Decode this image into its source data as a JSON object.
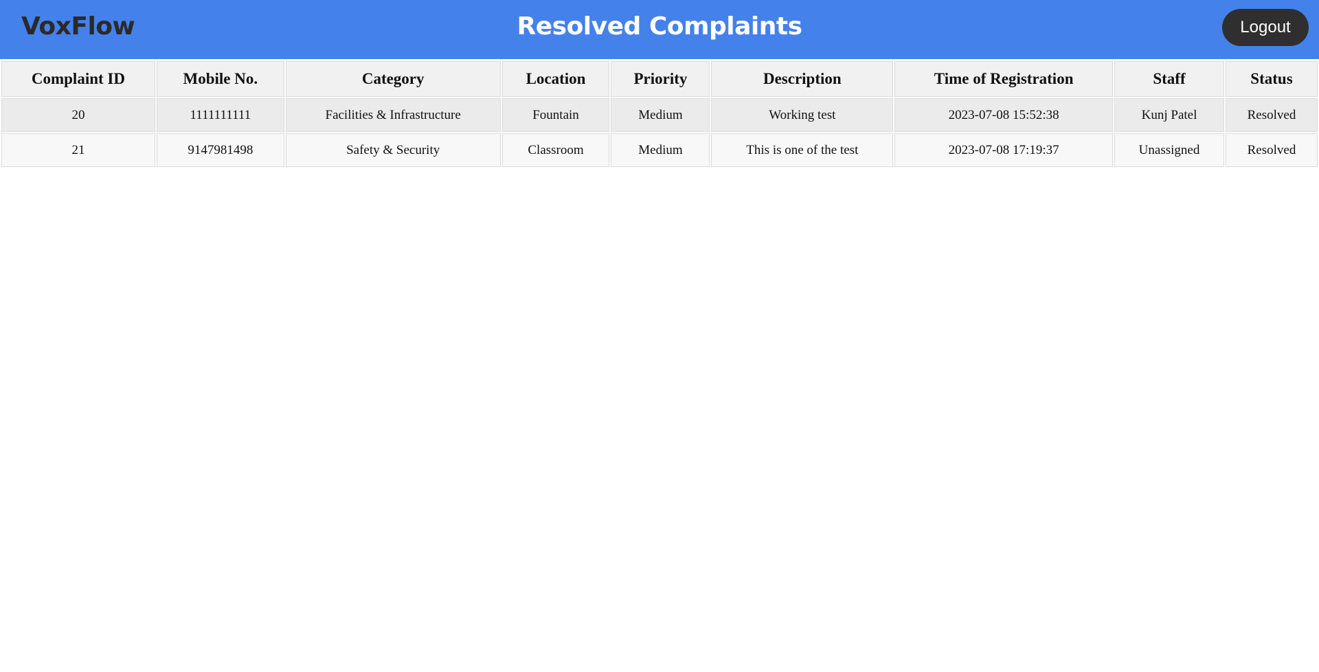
{
  "header": {
    "brand": "VoxFlow",
    "title": "Resolved Complaints",
    "logout_label": "Logout"
  },
  "colors": {
    "header_bg": "#4481ea",
    "logout_bg": "#2f2f2f"
  },
  "table": {
    "headers": [
      "Complaint ID",
      "Mobile No.",
      "Category",
      "Location",
      "Priority",
      "Description",
      "Time of Registration",
      "Staff",
      "Status"
    ],
    "rows": [
      [
        "20",
        "1111111111",
        "Facilities & Infrastructure",
        "Fountain",
        "Medium",
        "Working test",
        "2023-07-08 15:52:38",
        "Kunj Patel",
        "Resolved"
      ],
      [
        "21",
        "9147981498",
        "Safety & Security",
        "Classroom",
        "Medium",
        "This is one of the test",
        "2023-07-08 17:19:37",
        "Unassigned",
        "Resolved"
      ]
    ]
  }
}
